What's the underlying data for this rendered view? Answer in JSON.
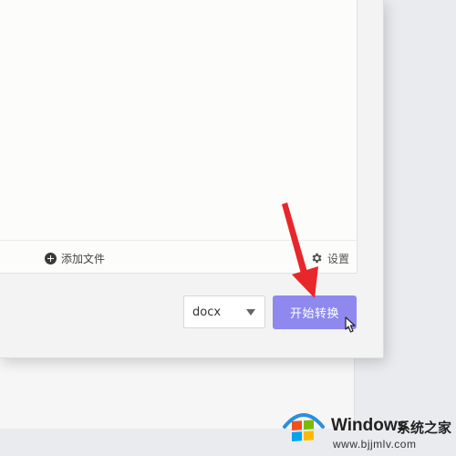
{
  "toolbar": {
    "add_file_label": "添加文件",
    "settings_label": "设置"
  },
  "footer": {
    "format_selected": "docx",
    "start_button_label": "开始转换"
  },
  "annotation": {
    "arrow_color": "#e8272b"
  },
  "colors": {
    "accent": "#8e88ef"
  },
  "icons": {
    "add": "plus-circle-icon",
    "settings": "gear-icon",
    "dropdown": "caret-down-icon",
    "cursor": "hand-pointer-icon"
  },
  "watermark": {
    "title": "Windows",
    "subtitle": "系统之家",
    "url": "www.bjjmlv.com"
  }
}
